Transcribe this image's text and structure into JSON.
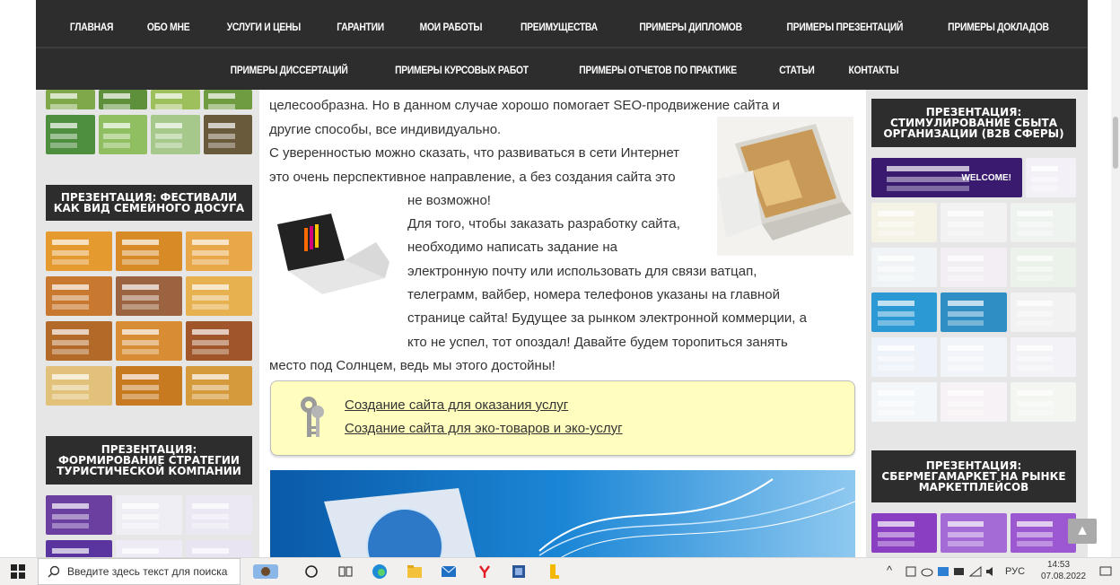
{
  "nav": {
    "row1": [
      "ГЛАВНАЯ",
      "ОБО МНЕ",
      "УСЛУГИ И ЦЕНЫ",
      "ГАРАНТИИ",
      "МОИ РАБОТЫ",
      "ПРЕИМУЩЕСТВА",
      "ПРИМЕРЫ ДИПЛОМОВ",
      "ПРИМЕРЫ ПРЕЗЕНТАЦИЙ",
      "ПРИМЕРЫ ДОКЛАДОВ"
    ],
    "row2": [
      "ПРИМЕРЫ ДИССЕРТАЦИЙ",
      "ПРИМЕРЫ КУРСОВЫХ РАБОТ",
      "ПРИМЕРЫ ОТЧЕТОВ ПО ПРАКТИКЕ",
      "СТАТЬИ",
      "КОНТАКТЫ"
    ]
  },
  "left": {
    "widget1_title": "ПРЕЗЕНТАЦИЯ: ФЕСТИВАЛИ КАК ВИД СЕМЕЙНОГО ДОСУГА",
    "widget2_title": "ПРЕЗЕНТАЦИЯ: ФОРМИРОВАНИЕ СТРАТЕГИИ ТУРИСТИЧЕСКОЙ КОМПАНИИ"
  },
  "right": {
    "widget1_title": "ПРЕЗЕНТАЦИЯ: СТИМУЛИРОВАНИЕ СБЫТА ОРГАНИЗАЦИИ (B2B СФЕРЫ)",
    "widget1_badge": "WELCOME!",
    "widget2_title": "ПРЕЗЕНТАЦИЯ: СБЕРМЕГАМАРКЕТ НА РЫНКЕ МАРКЕТПЛЕЙСОВ"
  },
  "article": {
    "lines": [
      "целесообразна. Но в данном случае хорошо помогает SEO-продвижение сайта и",
      "другие способы, все индивидуально.",
      "С уверенностью можно сказать, что развиваться в сети Интернет",
      "это очень перспективное направление, а без создания сайта это",
      "не возможно!",
      "Для того, чтобы заказать разработку сайта,",
      "необходимо написать задание на",
      "электронную почту или использовать для связи ватцап,",
      "телеграмм, вайбер, номера телефонов указаны на главной",
      "странице сайта! Будущее за рынком электронной коммерции, а",
      "кто не успел, тот опоздал! Давайте будем торопиться занять",
      "место под Солнцем, ведь мы этого достойны!"
    ],
    "link1": "Создание сайта для оказания услуг",
    "link2": "Создание сайта для эко-товаров и эко-услуг"
  },
  "taskbar": {
    "search_placeholder": "Введите здесь текст для поиска",
    "lang": "РУС",
    "time": "14:53",
    "date": "07.08.2022"
  },
  "colors": {
    "nav_bg": "#2d2d2d",
    "page_bg": "#e6e6e6",
    "link_box_bg": "#fffebf"
  }
}
